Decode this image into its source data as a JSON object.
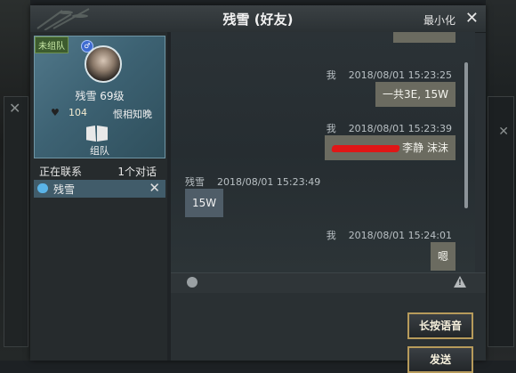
{
  "window": {
    "title": "残雪 (好友)",
    "minimize_label": "最小化",
    "close_label": "✕"
  },
  "profile": {
    "team_status": "未组队",
    "name_level": "残雪 69级",
    "intimacy": "104",
    "title": "恨相知晚",
    "team_button": "组队"
  },
  "contacts": {
    "header_left": "正在联系",
    "header_right": "1个对话",
    "items": [
      {
        "name": "残雪",
        "close": "✕"
      }
    ]
  },
  "messages": [
    {
      "sender": "我",
      "time": "2018/08/01  15:23:25",
      "text": "一共3E,   15W",
      "side": "right"
    },
    {
      "sender": "我",
      "time": "2018/08/01  15:23:39",
      "text": "李静  沫沫",
      "side": "right",
      "redacted": true
    },
    {
      "sender": "残雪",
      "time": "2018/08/01  15:23:49",
      "text": "15W",
      "side": "left"
    },
    {
      "sender": "我",
      "time": "2018/08/01  15:24:01",
      "text": "嗯",
      "side": "right"
    }
  ],
  "actions": {
    "voice": "长按语音",
    "send": "发送"
  },
  "colors": {
    "accent_border": "#b79b5b",
    "redaction": "#e01616",
    "contact_selected": "#415c6a"
  }
}
